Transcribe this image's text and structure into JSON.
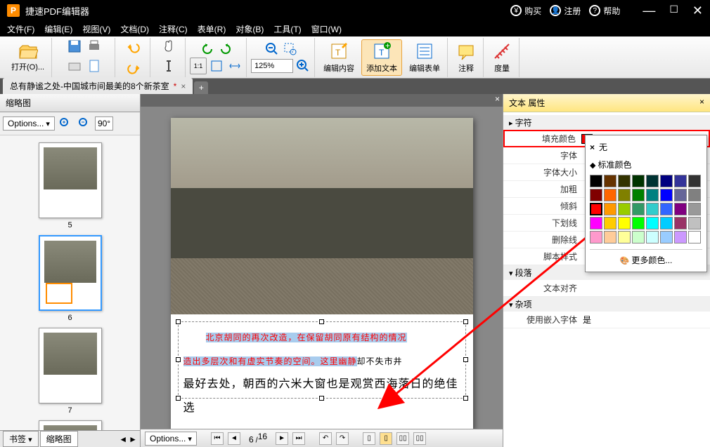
{
  "app": {
    "title": "捷速PDF编辑器"
  },
  "titlebar_buttons": {
    "buy": "购买",
    "register": "注册",
    "help": "帮助"
  },
  "menus": [
    "文件(F)",
    "编辑(E)",
    "视图(V)",
    "文档(D)",
    "注释(C)",
    "表单(R)",
    "对象(B)",
    "工具(T)",
    "窗口(W)"
  ],
  "toolbar": {
    "open": "打开(O)...",
    "zoom": "125%",
    "edit_content": "编辑内容",
    "add_text": "添加文本",
    "edit_form": "编辑表单",
    "annotate": "注释",
    "measure": "度量"
  },
  "tabs": {
    "doc1": "总有静谧之处-中国城市间最美的8个新茶室"
  },
  "thumb_panel": {
    "title": "缩略图",
    "options": "Options...",
    "rotate": "90°"
  },
  "thumbnails": [
    {
      "num": "5"
    },
    {
      "num": "6"
    },
    {
      "num": "7"
    }
  ],
  "bottom_tabs": {
    "bookmark": "书签",
    "thumbnail": "缩略图"
  },
  "doc_text": {
    "line1_a": "北京胡同的再次改造，在保留胡同原有结构的情况",
    "line2_a": "造出多层次和有虚实节奏的空间。这里幽静",
    "line2_b": "却不失市井",
    "line3": "最好去处，朝西的六米大窗也是观赏西海落日的绝佳选"
  },
  "status": {
    "options": "Options...",
    "page_cur": "6",
    "page_total": "16"
  },
  "props_panel": {
    "title": "文本 属性",
    "section_char": "字符",
    "fill_color": "填充颜色",
    "fill_value": "255,0,0",
    "font": "字体",
    "font_size": "字体大小",
    "bold": "加粗",
    "italic": "倾斜",
    "underline": "下划线",
    "strike": "删除线",
    "script_style": "脚本样式",
    "section_para": "段落",
    "text_align": "文本对齐",
    "section_misc": "杂项",
    "embed_font": "使用嵌入字体",
    "embed_val": "是"
  },
  "color_picker": {
    "none": "无",
    "std_colors": "标准颜色",
    "more": "更多颜色...",
    "colors": [
      [
        "#000000",
        "#663300",
        "#333300",
        "#003300",
        "#003333",
        "#000080",
        "#333399",
        "#333333"
      ],
      [
        "#800000",
        "#ff6600",
        "#808000",
        "#008000",
        "#008080",
        "#0000ff",
        "#666699",
        "#808080"
      ],
      [
        "#ff0000",
        "#ff9900",
        "#99cc00",
        "#339966",
        "#33cccc",
        "#3366ff",
        "#800080",
        "#999999"
      ],
      [
        "#ff00ff",
        "#ffcc00",
        "#ffff00",
        "#00ff00",
        "#00ffff",
        "#00ccff",
        "#993366",
        "#c0c0c0"
      ],
      [
        "#ff99cc",
        "#ffcc99",
        "#ffff99",
        "#ccffcc",
        "#ccffff",
        "#99ccff",
        "#cc99ff",
        "#ffffff"
      ]
    ]
  }
}
